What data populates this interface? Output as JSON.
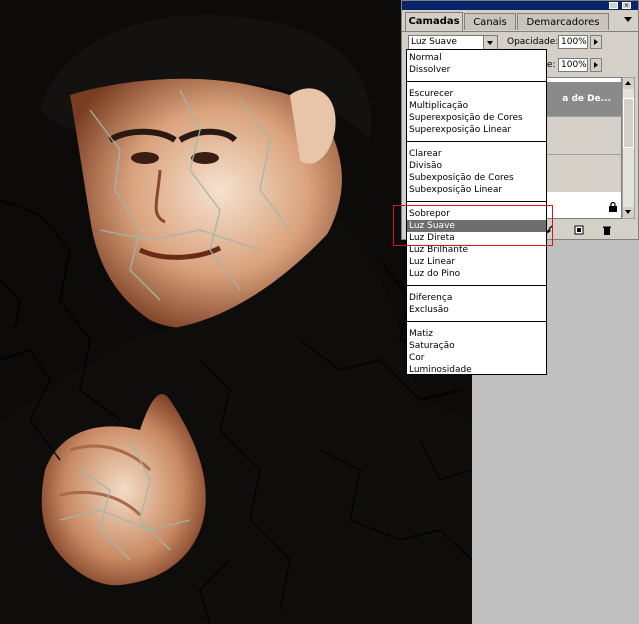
{
  "panel": {
    "tabs": [
      {
        "label": "Camadas"
      },
      {
        "label": "Canais"
      },
      {
        "label": "Demarcadores"
      }
    ],
    "blend_mode_value": "Luz Suave",
    "opacity_label": "Opacidade:",
    "opacity_value": "100%",
    "fill_label_partial": "e:",
    "fill_value": "100%",
    "selected_layer_name": "a de De..."
  },
  "blend_menu": {
    "groups": [
      [
        "Normal",
        "Dissolver"
      ],
      [
        "Escurecer",
        "Multiplicação",
        "Superexposição de Cores",
        "Superexposição Linear"
      ],
      [
        "Clarear",
        "Divisão",
        "Subexposição de Cores",
        "Subexposição Linear"
      ],
      [
        "Sobrepor",
        "Luz Suave",
        "Luz Direta",
        "Luz Brilhante",
        "Luz Linear",
        "Luz do Pino"
      ],
      [
        "Diferença",
        "Exclusão"
      ],
      [
        "Matiz",
        "Saturação",
        "Cor",
        "Luminosidade"
      ]
    ],
    "selected": "Luz Suave"
  },
  "colors": {
    "selection": "#6e6e6e",
    "highlight_box": "#d21a1a",
    "panel_bg": "#d4d0c8",
    "titlebar": "#0a246a"
  },
  "icons": [
    "close-icon",
    "panel-menu-icon",
    "dropdown-arrow-icon",
    "arrow-right-icon",
    "lock-icon",
    "new-layer-icon",
    "trash-icon",
    "brush-icon",
    "scroll-up-icon",
    "scroll-down-icon"
  ]
}
